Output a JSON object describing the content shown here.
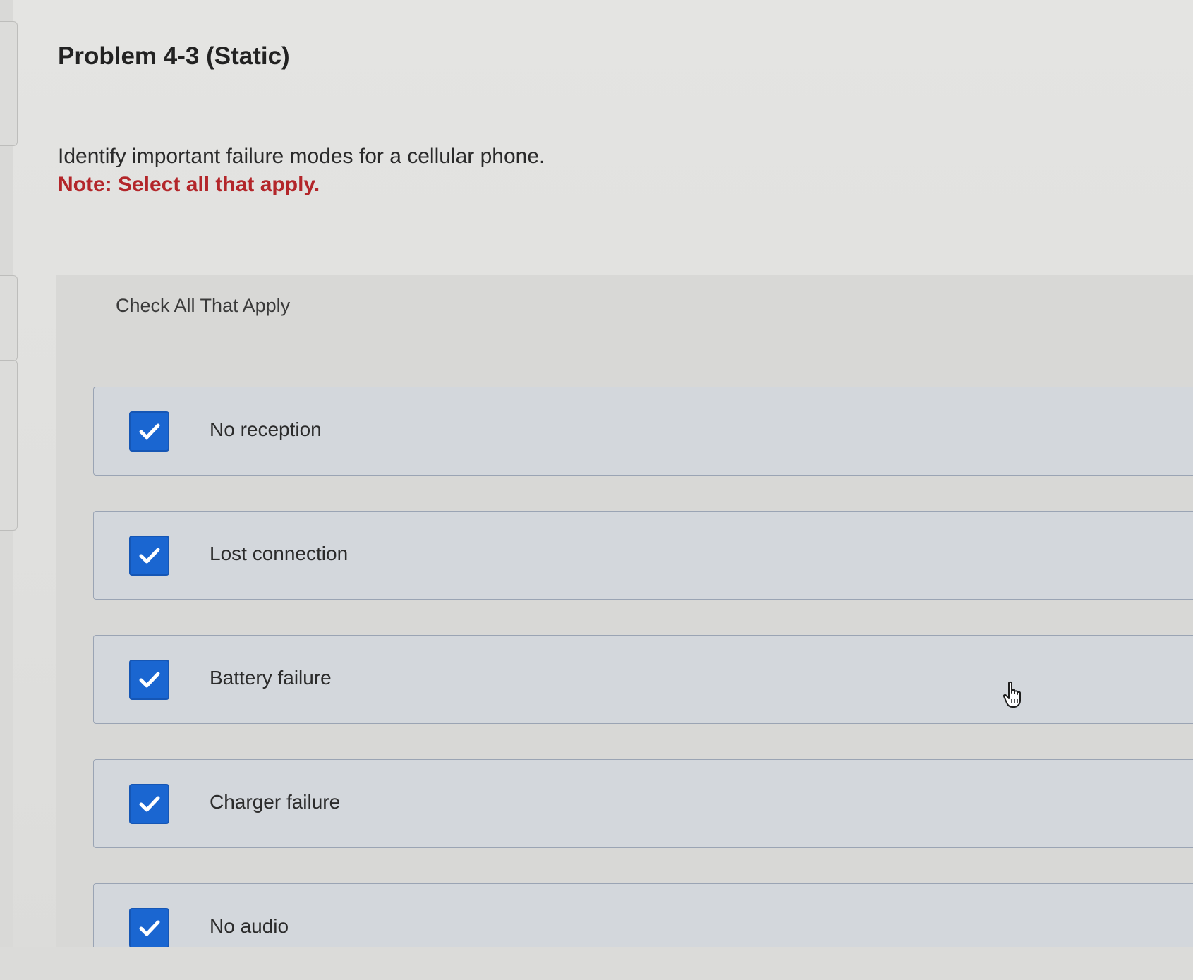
{
  "problem": {
    "title": "Problem 4-3 (Static)",
    "question": "Identify important failure modes for a cellular phone.",
    "note": "Note: Select all that apply."
  },
  "panel": {
    "heading": "Check All That Apply",
    "options": [
      {
        "label": "No reception",
        "checked": true
      },
      {
        "label": "Lost connection",
        "checked": true
      },
      {
        "label": "Battery failure",
        "checked": true
      },
      {
        "label": "Charger failure",
        "checked": true
      },
      {
        "label": "No audio",
        "checked": true
      }
    ]
  },
  "colors": {
    "note_red": "#b3262a",
    "checkbox_blue": "#1a66d1"
  },
  "icons": {
    "checkmark": "checkmark-icon",
    "cursor": "hand-pointer-icon"
  }
}
